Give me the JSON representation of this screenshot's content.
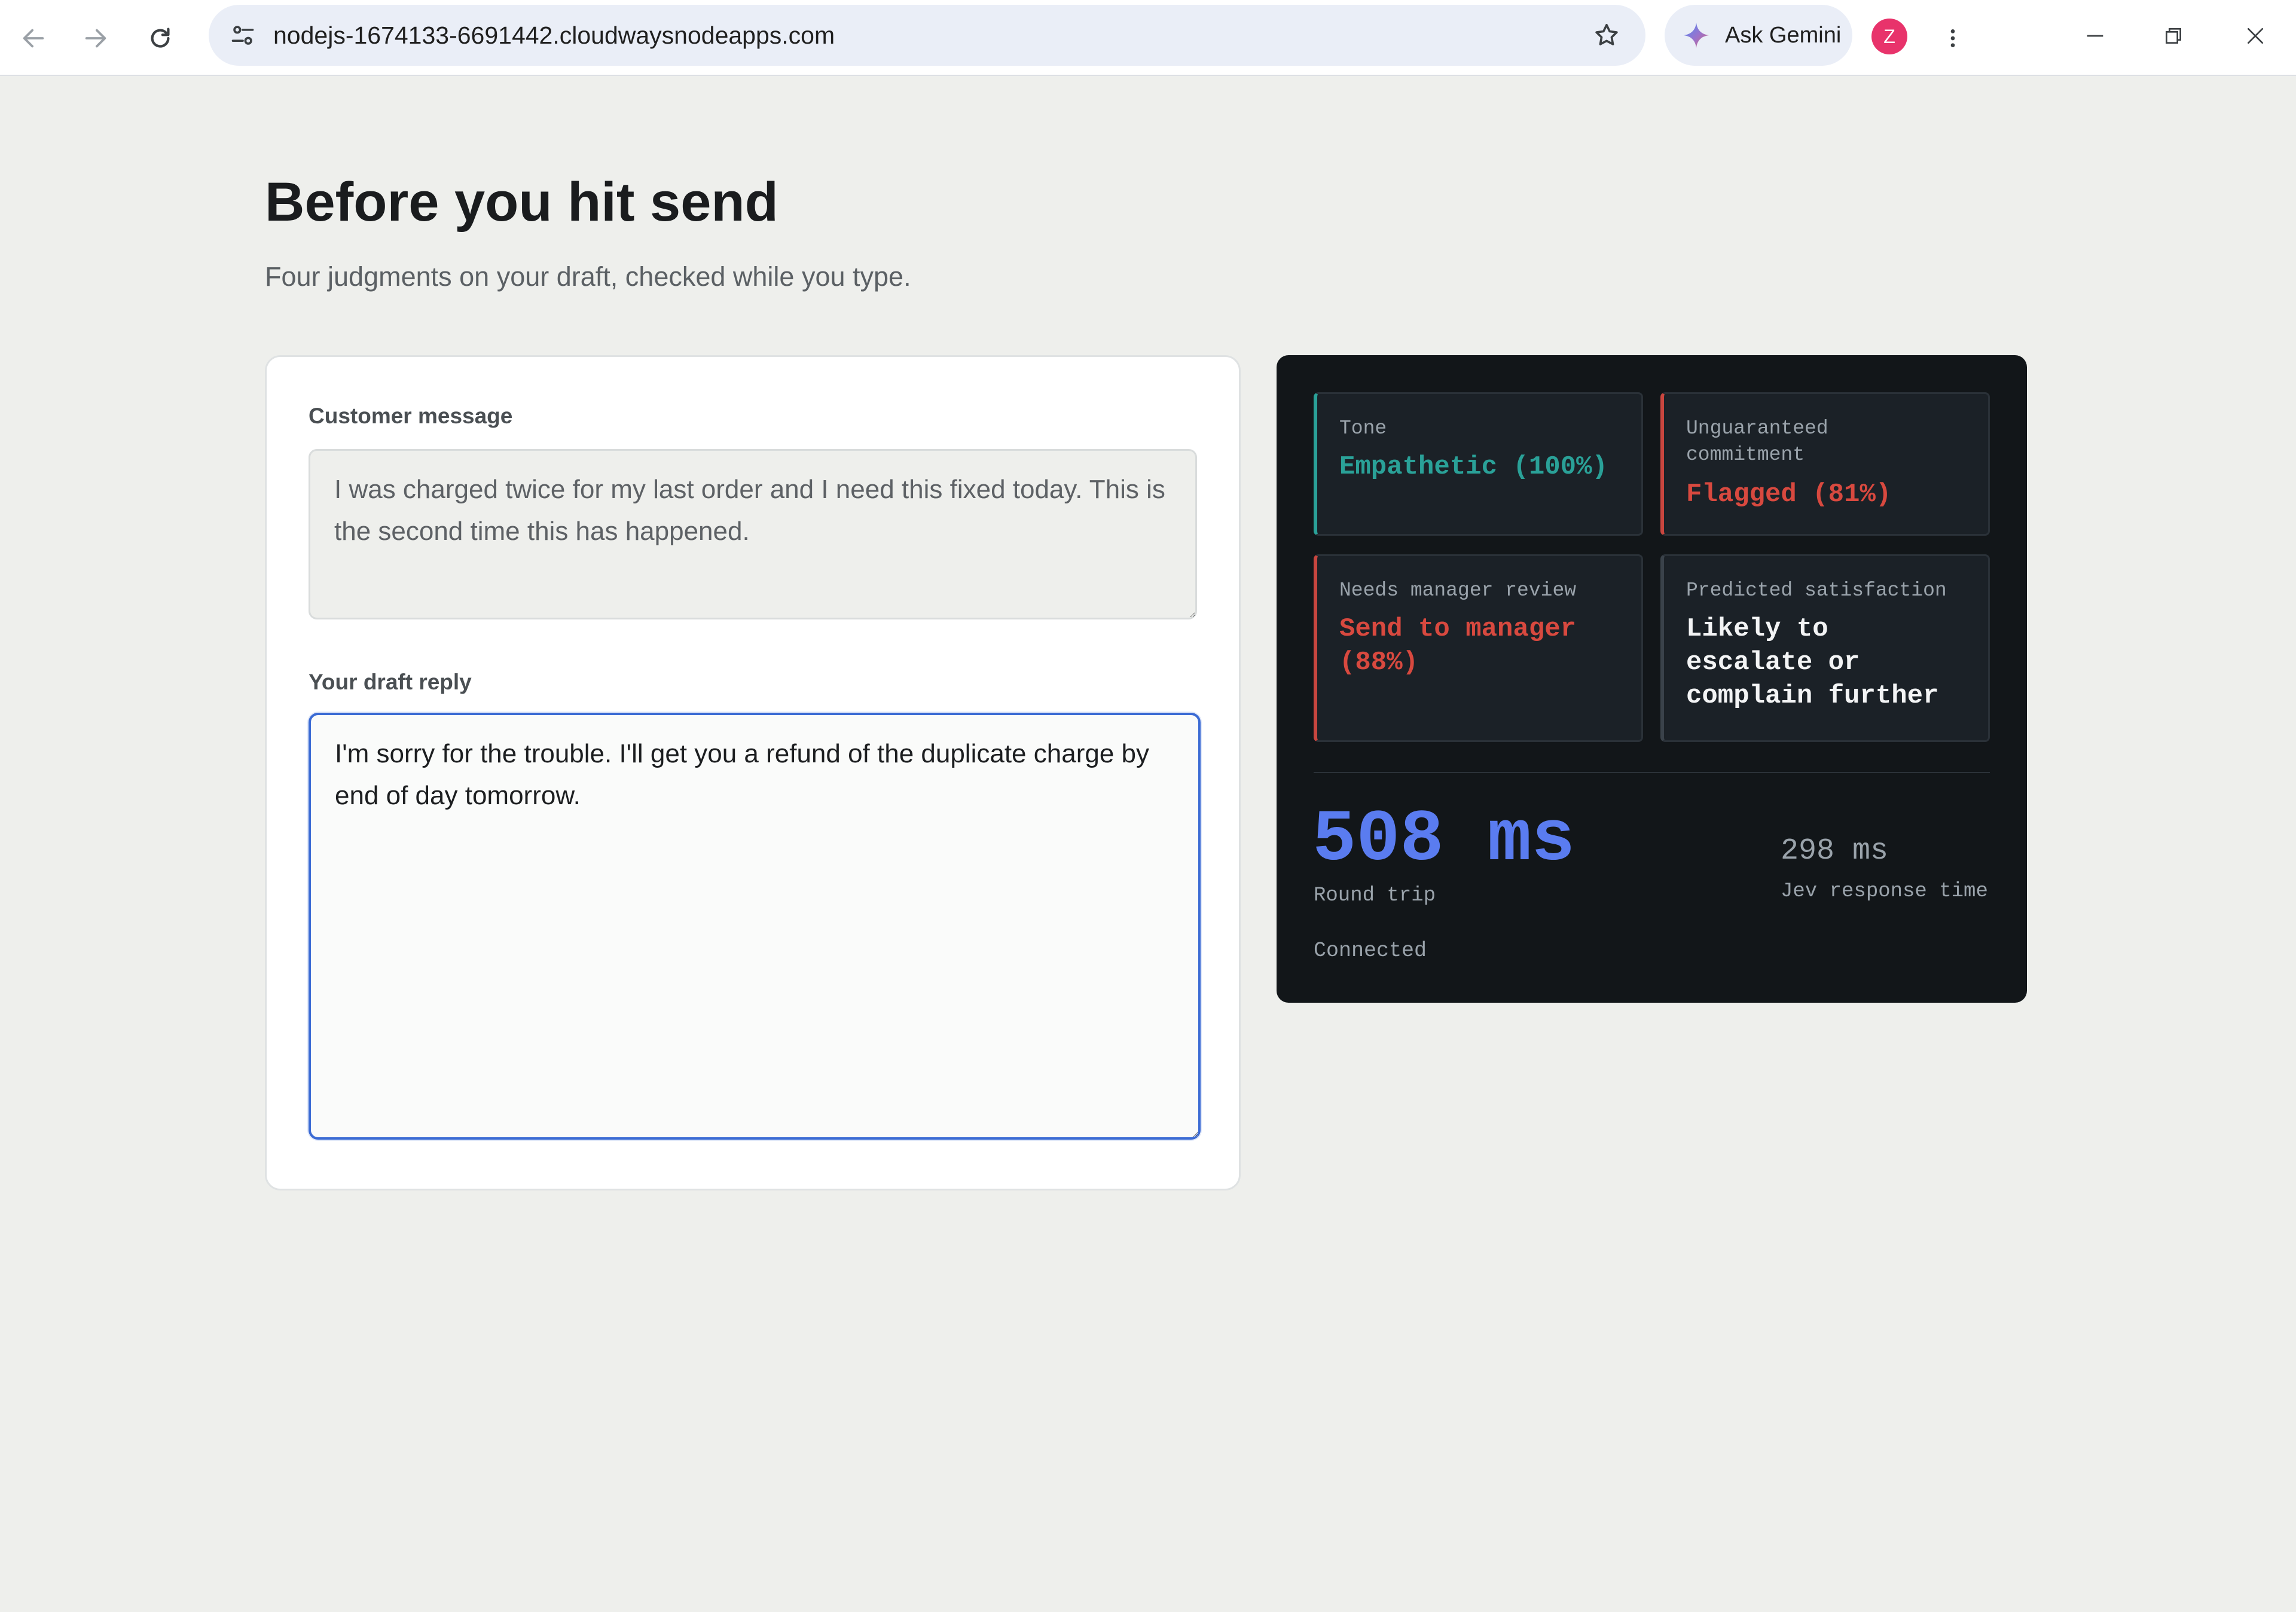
{
  "browser": {
    "url": "nodejs-1674133-6691442.cloudwaysnodeapps.com",
    "gemini_label": "Ask Gemini",
    "profile_initial": "Z",
    "profile_color": "#e8336b",
    "icons": {
      "back": "arrow-left-icon",
      "forward": "arrow-right-icon",
      "reload": "reload-icon",
      "site_info": "tune-icon",
      "bookmark": "star-icon",
      "gemini": "gemini-spark-icon",
      "menu": "kebab-menu-icon",
      "minimize": "minimize-icon",
      "restore": "restore-icon",
      "close": "close-icon"
    }
  },
  "page": {
    "title": "Before you hit send",
    "subtitle": "Four judgments on your draft, checked while you type."
  },
  "compose": {
    "customer_label": "Customer message",
    "customer_message": "I was charged twice for my last order and I need this fixed today. This is the second time this has happened.",
    "draft_label": "Your draft reply",
    "draft_reply": "I'm sorry for the trouble. I'll get you a refund of the duplicate charge by end of day tomorrow."
  },
  "judgments": [
    {
      "label": "Tone",
      "value": "Empathetic (100%)",
      "accent": "#2aa198",
      "value_color": "#2aa198"
    },
    {
      "label": "Unguaranteed commitment",
      "value": "Flagged (81%)",
      "accent": "#c8463f",
      "value_color": "#d8493f"
    },
    {
      "label": "Needs manager review",
      "value": "Send to manager (88%)",
      "accent": "#c8463f",
      "value_color": "#d8493f"
    },
    {
      "label": "Predicted satisfaction",
      "value": "Likely to escalate or complain further",
      "accent": "#3a424a",
      "value_color": "#f3f4f5"
    }
  ],
  "metrics": {
    "round_trip_value": "508 ms",
    "round_trip_label": "Round trip",
    "response_value": "298 ms",
    "response_label": "Jev response time",
    "status": "Connected",
    "accent": "#5a7cf0"
  }
}
